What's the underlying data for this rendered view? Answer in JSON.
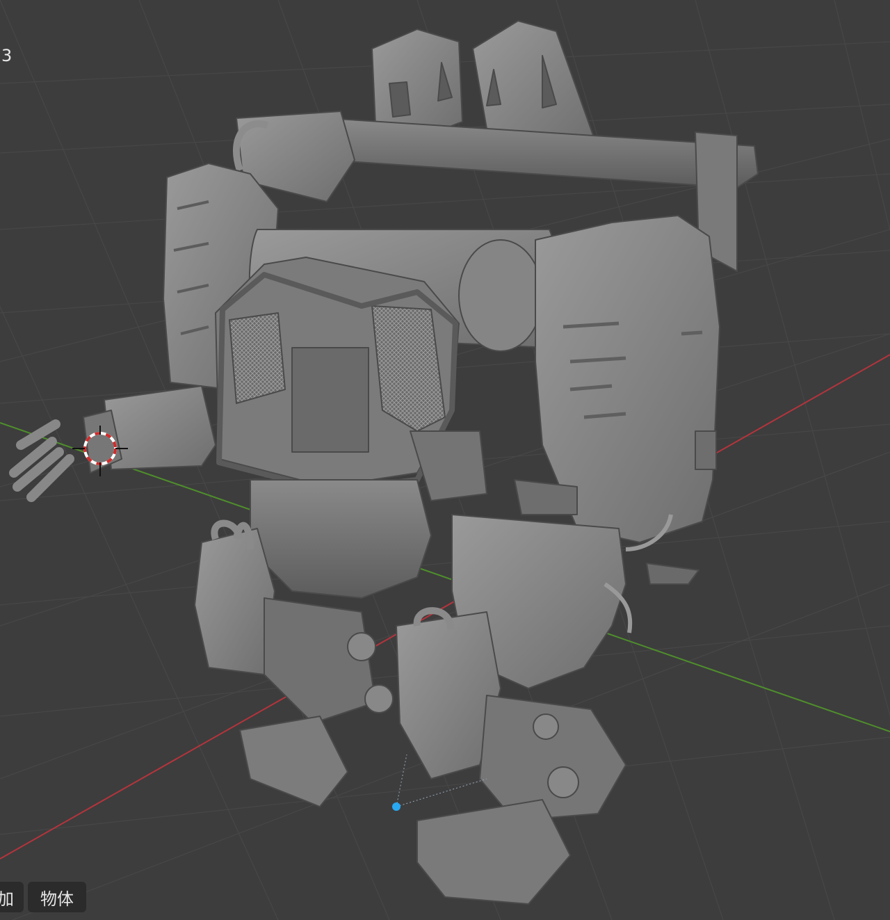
{
  "viewport": {
    "corner_text": "3",
    "menu": [
      {
        "label": "加"
      },
      {
        "label": "物体"
      }
    ]
  },
  "colors": {
    "background": "#3d3d3d",
    "grid": "#454545",
    "x_axis": "#b5343c",
    "y_axis": "#4f8f2c",
    "origin": "#29a8f2",
    "model": "#8a8a8a"
  },
  "icons": {
    "cursor": "3d-cursor-icon",
    "origin": "object-origin-icon"
  }
}
